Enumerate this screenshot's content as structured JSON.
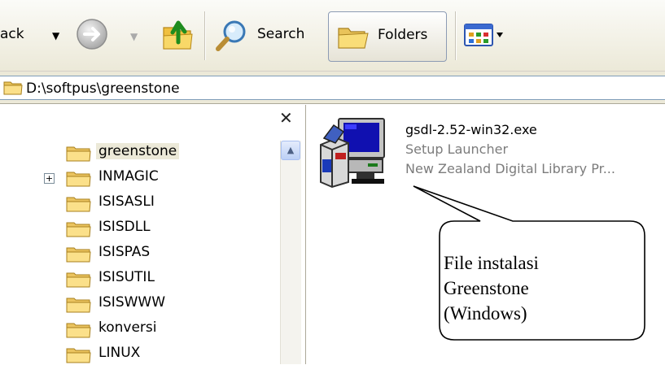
{
  "toolbar": {
    "back_label": "ack",
    "search_label": "Search",
    "folders_label": "Folders"
  },
  "address": {
    "path": "D:\\softpus\\greenstone"
  },
  "tree": {
    "items": [
      {
        "label": "greenstone",
        "selected": true
      },
      {
        "label": "INMAGIC",
        "expandable": true
      },
      {
        "label": "ISISASLI"
      },
      {
        "label": "ISISDLL"
      },
      {
        "label": "ISISPAS"
      },
      {
        "label": "ISISUTIL"
      },
      {
        "label": "ISISWWW"
      },
      {
        "label": "konversi"
      },
      {
        "label": "LINUX"
      }
    ]
  },
  "file": {
    "name": "gsdl-2.52-win32.exe",
    "type": "Setup Launcher",
    "company": "New Zealand Digital Library Pr..."
  },
  "callout": {
    "line1": "File instalasi",
    "line2": "Greenstone",
    "line3": "(Windows)"
  },
  "icons": {
    "back": "back-arrow-icon",
    "forward": "forward-arrow-icon",
    "up": "up-folder-icon",
    "search": "search-icon",
    "folders": "folders-icon",
    "views": "views-icon",
    "close": "close-icon",
    "scroll_up": "scroll-up-icon",
    "setup": "setup-launcher-icon"
  },
  "colors": {
    "toolbar_bg": "#ece9d8",
    "folder_yellow": "#f6d776",
    "selection": "#ece9d8",
    "secondary_text": "#7c7c7c"
  }
}
